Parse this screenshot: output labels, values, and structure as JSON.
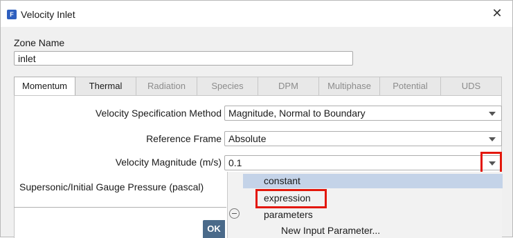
{
  "window": {
    "title": "Velocity Inlet",
    "app_icon_glyph": "F"
  },
  "zone": {
    "label": "Zone Name",
    "value": "inlet"
  },
  "tabs": [
    {
      "label": "Momentum"
    },
    {
      "label": "Thermal"
    },
    {
      "label": "Radiation"
    },
    {
      "label": "Species"
    },
    {
      "label": "DPM"
    },
    {
      "label": "Multiphase"
    },
    {
      "label": "Potential"
    },
    {
      "label": "UDS"
    }
  ],
  "momentum": {
    "spec_method": {
      "label": "Velocity Specification Method",
      "value": "Magnitude, Normal to Boundary"
    },
    "reference_frame": {
      "label": "Reference Frame",
      "value": "Absolute"
    },
    "velocity_magnitude": {
      "label": "Velocity Magnitude (m/s)",
      "value": "0.1"
    },
    "pressure": {
      "label": "Supersonic/Initial Gauge Pressure (pascal)"
    }
  },
  "menu": {
    "items": [
      "constant",
      "expression",
      "parameters",
      "New Input Parameter..."
    ]
  },
  "buttons": {
    "ok": "OK"
  },
  "colors": {
    "highlight": "#e3170a",
    "selected_item": "#c4d3e8",
    "accent": "#2e5fbf"
  }
}
